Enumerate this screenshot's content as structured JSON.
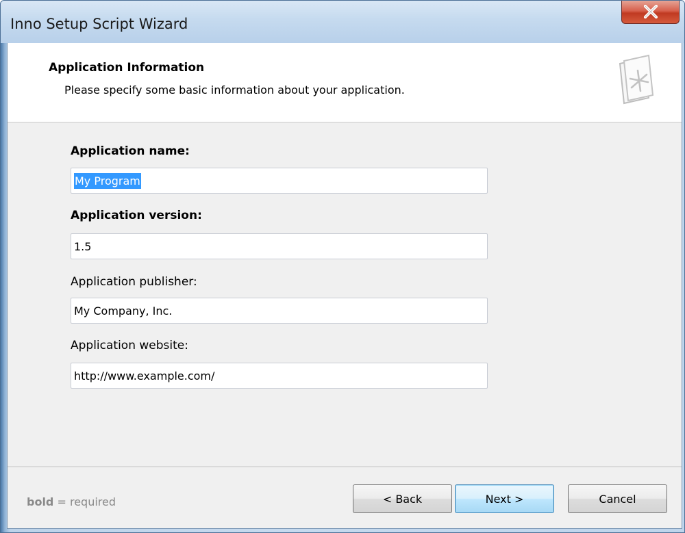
{
  "window": {
    "title": "Inno Setup Script Wizard"
  },
  "header": {
    "title": "Application Information",
    "subtitle": "Please specify some basic information about your application."
  },
  "fields": [
    {
      "label": "Application name:",
      "value": "My Program",
      "required": true,
      "selected": true
    },
    {
      "label": "Application version:",
      "value": "1.5",
      "required": true,
      "selected": false
    },
    {
      "label": "Application publisher:",
      "value": "My Company, Inc.",
      "required": false,
      "selected": false
    },
    {
      "label": "Application website:",
      "value": "http://www.example.com/",
      "required": false,
      "selected": false
    }
  ],
  "footer": {
    "hint_bold": "bold",
    "hint_rest": " = required",
    "back_label": "< Back",
    "next_label": "Next >",
    "cancel_label": "Cancel"
  },
  "icons": {
    "close": "close-icon",
    "wizard": "wizard-document-icon"
  },
  "colors": {
    "selection": "#3399ff",
    "close_button": "#c8442b",
    "default_button_border": "#3c7fb1"
  }
}
